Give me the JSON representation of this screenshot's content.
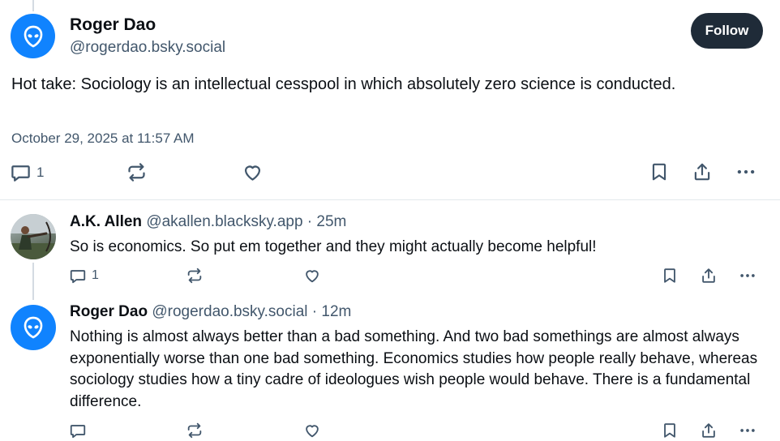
{
  "main_post": {
    "author_name": "Roger Dao",
    "author_handle": "@rogerdao.bsky.social",
    "follow_label": "Follow",
    "text": "Hot take: Sociology is an intellectual cesspool in which absolutely zero science is conducted.",
    "date": "October 29, 2025 at 11:57 AM",
    "reply_count": "1",
    "icons": [
      "reply-icon",
      "repost-icon",
      "like-icon",
      "bookmark-icon",
      "share-icon",
      "more-icon"
    ]
  },
  "replies": [
    {
      "author_name": "A.K. Allen",
      "author_handle": "@akallen.blacksky.app",
      "time": "· 25m",
      "text": "So is economics. So put em together and they might actually become helpful!",
      "reply_count": "1"
    },
    {
      "author_name": "Roger Dao",
      "author_handle": "@rogerdao.bsky.social",
      "time": "· 12m",
      "text": "Nothing is almost always better than a bad something. And two bad somethings are almost always exponentially worse than one bad something. Economics studies how people really behave, whereas sociology studies how a tiny cadre of ideologues wish people would behave. There is a fundamental difference.",
      "reply_count": ""
    }
  ],
  "colors": {
    "accent": "#1083fe",
    "follow_bg": "#1f2b38",
    "muted_text": "#42576c",
    "thread_line": "#d4dbe2"
  }
}
